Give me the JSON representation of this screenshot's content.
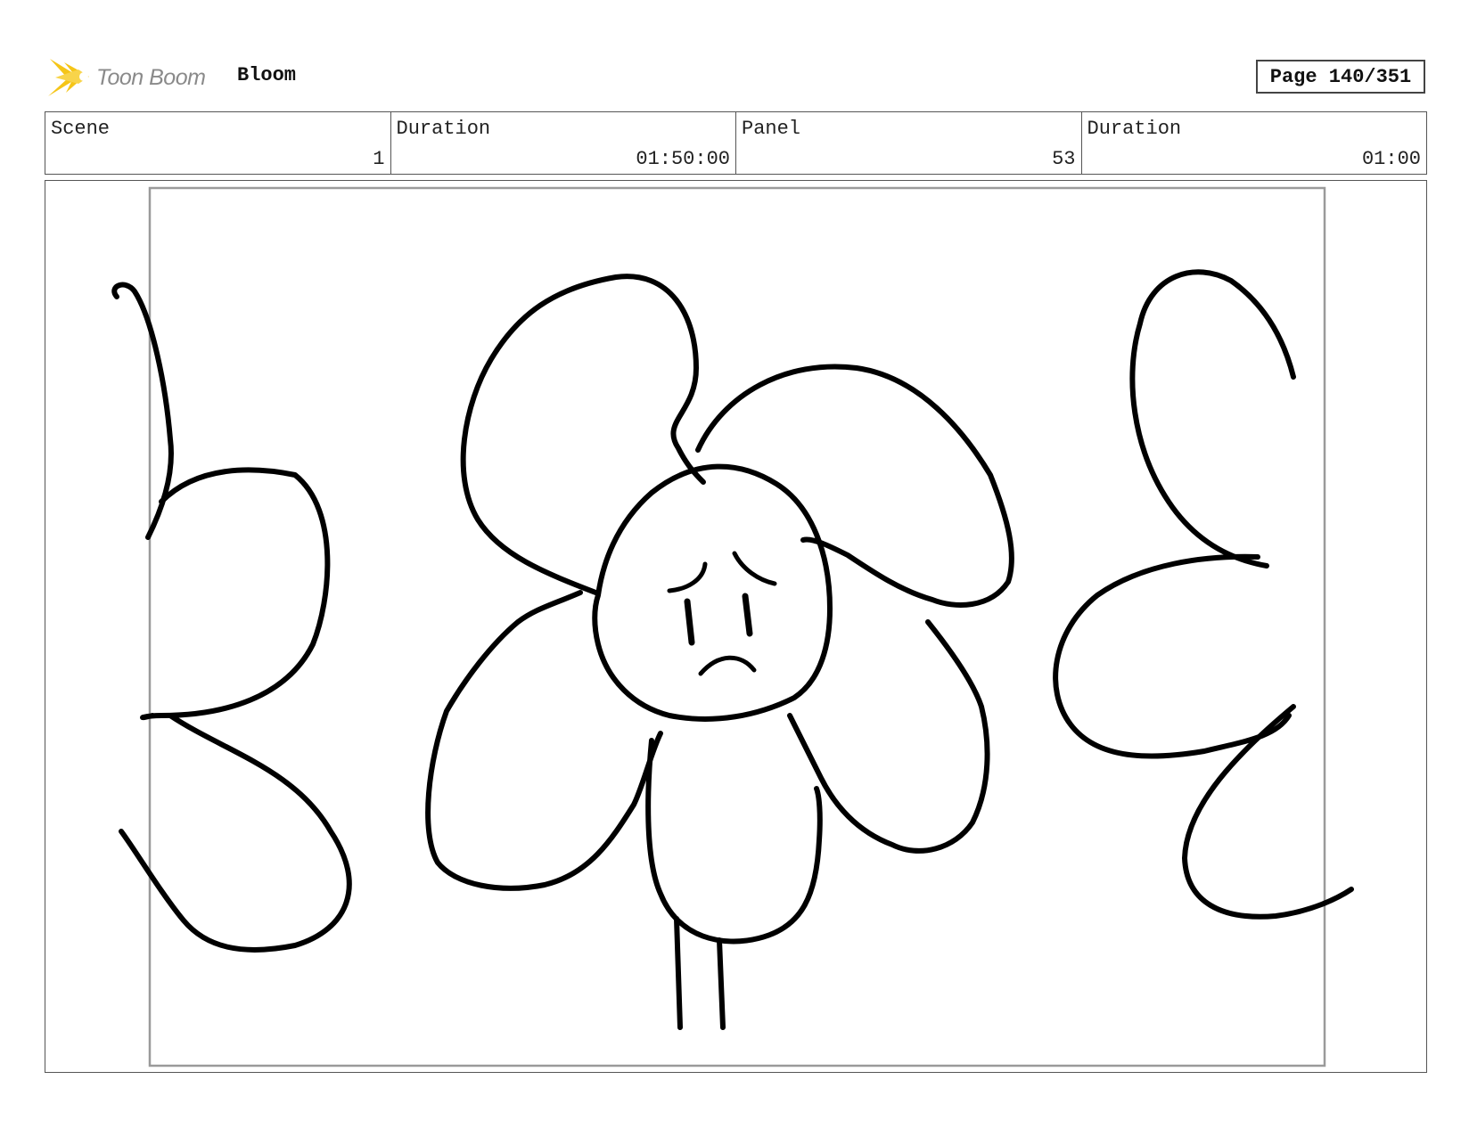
{
  "header": {
    "brand": "Toon Boom",
    "project_title": "Bloom",
    "page_label": "Page 140/351"
  },
  "info": {
    "scene_label": "Scene",
    "scene_value": "1",
    "duration_label": "Duration",
    "duration_value": "01:50:00",
    "panel_label": "Panel",
    "panel_value": "53",
    "panel_duration_label": "Duration",
    "panel_duration_value": "01:00"
  },
  "colors": {
    "logo_accent": "#f5c518",
    "ink": "#000000",
    "frame": "#9a9a9a"
  }
}
